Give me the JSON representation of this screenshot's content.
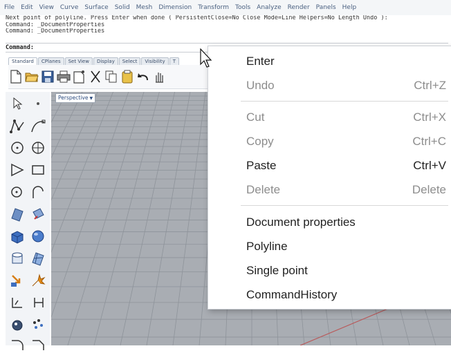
{
  "menubar": {
    "items": [
      "File",
      "Edit",
      "View",
      "Curve",
      "Surface",
      "Solid",
      "Mesh",
      "Dimension",
      "Transform",
      "Tools",
      "Analyze",
      "Render",
      "Panels",
      "Help"
    ]
  },
  "command_history": {
    "lines": [
      "Next point of polyline. Press Enter when done ( PersistentClose=No  Close  Mode=Line  Helpers=No  Length  Undo ):",
      "Command: _DocumentProperties",
      "Command: _DocumentProperties"
    ],
    "prompt_label": "Command:",
    "prompt_value": ""
  },
  "toolbar_tabs": [
    "Standard",
    "CPlanes",
    "Set View",
    "Display",
    "Select",
    "Visibility",
    "T"
  ],
  "viewport": {
    "label": "Perspective",
    "label_arrow": "▼",
    "background": "#a9adb3",
    "grid_color": "#8e939a"
  },
  "context_menu": {
    "items": [
      {
        "label": "Enter",
        "shortcut": "",
        "enabled": true
      },
      {
        "label": "Undo",
        "shortcut": "Ctrl+Z",
        "enabled": false
      },
      {
        "label": "Cut",
        "shortcut": "Ctrl+X",
        "enabled": false
      },
      {
        "label": "Copy",
        "shortcut": "Ctrl+C",
        "enabled": false
      },
      {
        "label": "Paste",
        "shortcut": "Ctrl+V",
        "enabled": true
      },
      {
        "label": "Delete",
        "shortcut": "Delete",
        "enabled": false
      },
      {
        "label": "Document properties",
        "shortcut": "",
        "enabled": true
      },
      {
        "label": "Polyline",
        "shortcut": "",
        "enabled": true
      },
      {
        "label": "Single point",
        "shortcut": "",
        "enabled": true
      },
      {
        "label": "CommandHistory",
        "shortcut": "",
        "enabled": true
      }
    ]
  },
  "colors": {
    "enabled_text": "#222222",
    "disabled_text": "#8d8d8d",
    "menubar_text": "#4a6080"
  }
}
